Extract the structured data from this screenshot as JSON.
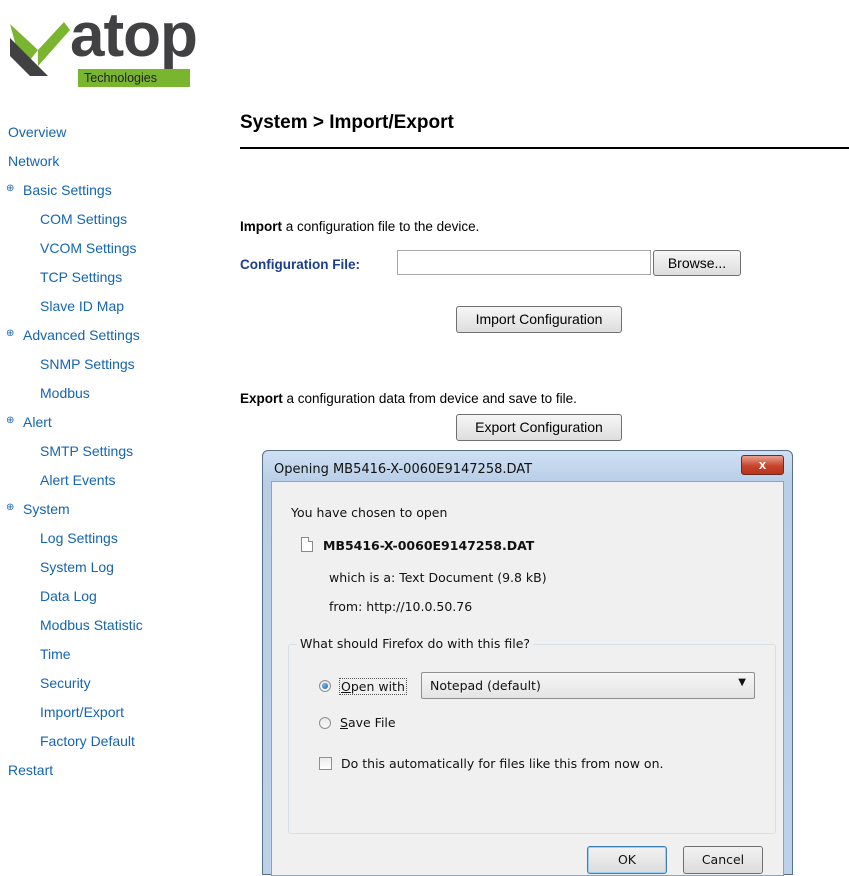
{
  "logo": {
    "word": "atop",
    "tagline": "Technologies"
  },
  "colors": {
    "link": "#1464b4",
    "brand_green": "#7ab52f",
    "label_blue": "#1a3d8f"
  },
  "sidebar": {
    "items": [
      {
        "label": "Overview",
        "level": 0,
        "bullet": false
      },
      {
        "label": "Network",
        "level": 0,
        "bullet": false
      },
      {
        "label": "Basic Settings",
        "level": 0,
        "bullet": true
      },
      {
        "label": "COM Settings",
        "level": 1,
        "bullet": false
      },
      {
        "label": "VCOM Settings",
        "level": 1,
        "bullet": false
      },
      {
        "label": "TCP Settings",
        "level": 1,
        "bullet": false
      },
      {
        "label": "Slave ID Map",
        "level": 1,
        "bullet": false
      },
      {
        "label": "Advanced Settings",
        "level": 0,
        "bullet": true
      },
      {
        "label": "SNMP Settings",
        "level": 1,
        "bullet": false
      },
      {
        "label": "Modbus",
        "level": 1,
        "bullet": false
      },
      {
        "label": "Alert",
        "level": 0,
        "bullet": true
      },
      {
        "label": "SMTP Settings",
        "level": 1,
        "bullet": false
      },
      {
        "label": "Alert Events",
        "level": 1,
        "bullet": false
      },
      {
        "label": "System",
        "level": 0,
        "bullet": true
      },
      {
        "label": "Log Settings",
        "level": 1,
        "bullet": false
      },
      {
        "label": "System Log",
        "level": 1,
        "bullet": false
      },
      {
        "label": "Data Log",
        "level": 1,
        "bullet": false
      },
      {
        "label": "Modbus Statistic",
        "level": 1,
        "bullet": false
      },
      {
        "label": "Time",
        "level": 1,
        "bullet": false
      },
      {
        "label": "Security",
        "level": 1,
        "bullet": false
      },
      {
        "label": "Import/Export",
        "level": 1,
        "bullet": false
      },
      {
        "label": "Factory Default",
        "level": 1,
        "bullet": false
      },
      {
        "label": "Restart",
        "level": 0,
        "bullet": false
      }
    ]
  },
  "main": {
    "title": "System > Import/Export",
    "import": {
      "bold": "Import",
      "text": " a configuration file to the device.",
      "file_label": "Configuration File:",
      "file_value": "",
      "browse_label": "Browse...",
      "button_label": "Import Configuration"
    },
    "export": {
      "bold": "Export",
      "text": " a configuration data from device and save to file.",
      "button_label": "Export Configuration"
    }
  },
  "dialog": {
    "title": "Opening MB5416-X-0060E9147258.DAT",
    "close_label": "x",
    "chosen_text": "You have chosen to open",
    "filename": "MB5416-X-0060E9147258.DAT",
    "which_is_label": "which is a:",
    "which_is_value": "Text Document (9.8 kB)",
    "from_label": "from:",
    "from_value": "http://10.0.50.76",
    "group_label": "What should Firefox do with this file?",
    "open_with_label": "Open with",
    "open_with_value": "Notepad (default)",
    "save_file_label": "Save File",
    "auto_label": "Do this automatically for files like this from now on.",
    "selected_option": "open_with",
    "auto_checked": false,
    "ok_label": "OK",
    "cancel_label": "Cancel"
  }
}
